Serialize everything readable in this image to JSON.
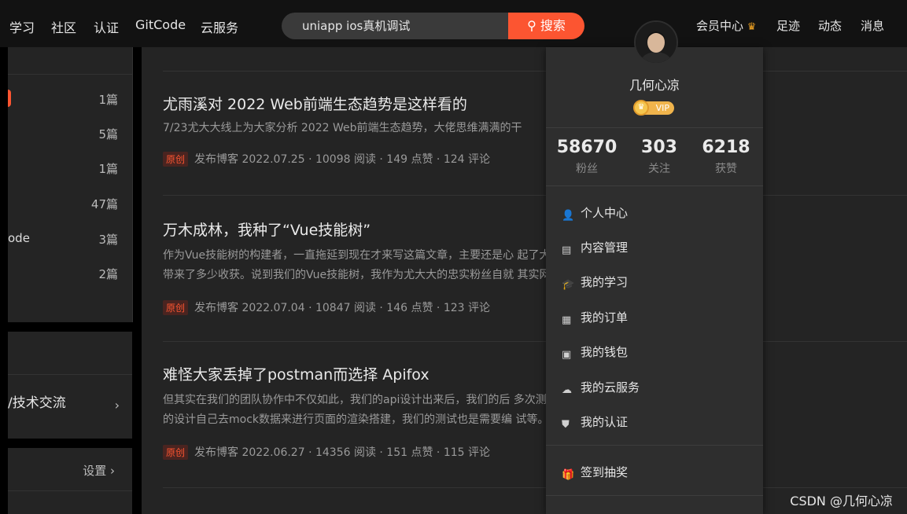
{
  "topnav": {
    "items": [
      "学习",
      "社区",
      "认证",
      "GitCode",
      "云服务"
    ],
    "search_value": "uniapp ios真机调试",
    "search_button": "搜索",
    "right_items": [
      "会员中心",
      "足迹",
      "动态",
      "消息"
    ]
  },
  "sidebar": {
    "counts": [
      "1篇",
      "5篇",
      "1篇",
      "47篇",
      "3篇",
      "2篇"
    ],
    "partial_label": "ode",
    "group_label": "/技术交流",
    "settings_label": "设置"
  },
  "articles": [
    {
      "title": "尤雨溪对 2022 Web前端生态趋势是这样看的",
      "desc": [
        "7/23尤大大线上为大家分析 2022 Web前端生态趋势，大佬思维满满的干"
      ],
      "tag": "原创",
      "meta": "发布博客 2022.07.25 · 10098 阅读 · 149 点赞 · 124 评论"
    },
    {
      "title": "万木成林，我种了“Vue技能树”",
      "desc": [
        "作为Vue技能树的构建者，一直拖延到现在才来写这篇文章，主要还是心                                            起了大家学习的热情，也不",
        "带来了多少收获。说到我们的Vue技能树，我作为尤大大的忠实粉丝自就                                            其实网上有过很多很多前"
      ],
      "tag": "原创",
      "meta": "发布博客 2022.07.04 · 10847 阅读 · 146 点赞 · 123 评论"
    },
    {
      "title": "难怪大家丢掉了postman而选择 Apifox",
      "desc": [
        "但其实在我们的团队协作中不仅如此，我们的api设计出来后，我们的后                                            多次测试，我们的前端同学",
        "的设计自己去mock数据来进行页面的渲染搭建，我们的测试也是需要编                                            试等。我们能够感受到我们"
      ],
      "tag": "原创",
      "meta": "发布博客 2022.06.27 · 14356 阅读 · 151 点赞 · 115 评论"
    }
  ],
  "user": {
    "name": "几何心凉",
    "vip": "VIP",
    "stats": [
      {
        "num": "58670",
        "label": "粉丝"
      },
      {
        "num": "303",
        "label": "关注"
      },
      {
        "num": "6218",
        "label": "获赞"
      }
    ]
  },
  "menu": [
    {
      "label": "个人中心",
      "icon": "user-icon"
    },
    {
      "label": "内容管理",
      "icon": "document-icon"
    },
    {
      "label": "我的学习",
      "icon": "graduation-cap-icon"
    },
    {
      "label": "我的订单",
      "icon": "order-icon"
    },
    {
      "label": "我的钱包",
      "icon": "wallet-icon"
    },
    {
      "label": "我的云服务",
      "icon": "cloud-service-icon"
    },
    {
      "label": "我的认证",
      "icon": "certification-shield-icon"
    },
    {
      "label": "签到抽奖",
      "icon": "gift-icon"
    }
  ],
  "watermark": "CSDN @几何心凉",
  "colors": {
    "accent": "#fc5531",
    "vip": "#f0b44c",
    "background": "#242424"
  }
}
